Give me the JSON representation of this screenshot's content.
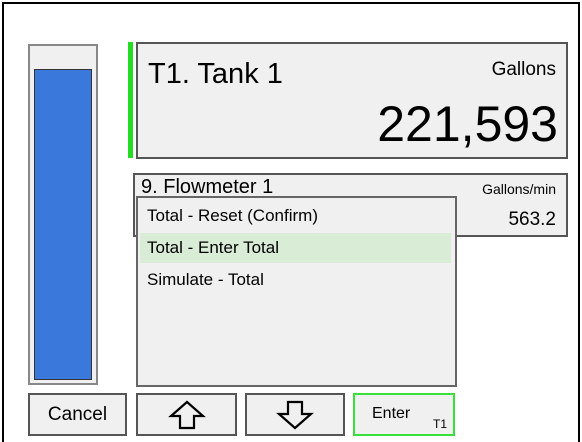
{
  "level_bar": {
    "fill_fraction": 0.94,
    "fill_color": "#3b78db"
  },
  "tank": {
    "name": "T1. Tank 1",
    "units": "Gallons",
    "value": "221,593",
    "accent_color": "#22dd22"
  },
  "flowmeter": {
    "name": "9. Flowmeter 1",
    "units": "Gallons/min",
    "value": "563.2"
  },
  "menu": {
    "items": [
      {
        "label": "Total - Reset (Confirm)",
        "selected": false
      },
      {
        "label": "Total - Enter Total",
        "selected": true
      },
      {
        "label": "Simulate - Total",
        "selected": false
      }
    ]
  },
  "buttons": {
    "cancel": "Cancel",
    "up_icon": "up-arrow-icon",
    "down_icon": "down-arrow-icon",
    "enter": "Enter",
    "enter_sub": "T1"
  }
}
